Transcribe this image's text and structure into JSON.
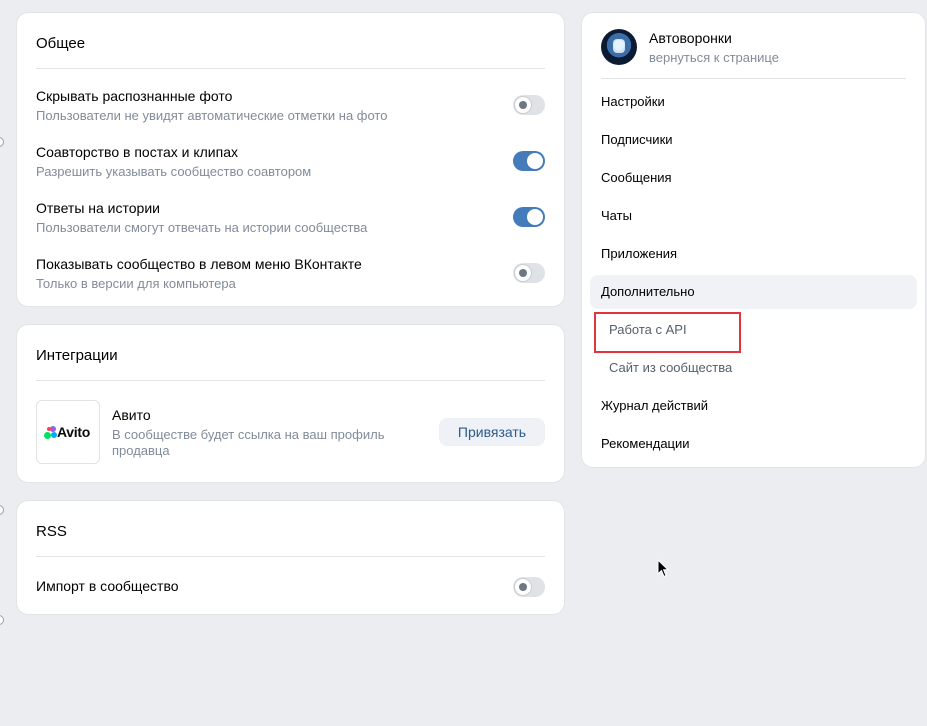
{
  "general": {
    "title": "Общее",
    "settings": [
      {
        "title": "Скрывать распознанные фото",
        "subtitle": "Пользователи не увидят автоматические отметки на фото",
        "enabled": false
      },
      {
        "title": "Соавторство в постах и клипах",
        "subtitle": "Разрешить указывать сообщество соавтором",
        "enabled": true
      },
      {
        "title": "Ответы на истории",
        "subtitle": "Пользователи смогут отвечать на истории сообщества",
        "enabled": true
      },
      {
        "title": "Показывать сообщество в левом меню ВКонтакте",
        "subtitle": "Только в версии для компьютера",
        "enabled": false
      }
    ]
  },
  "integrations": {
    "title": "Интеграции",
    "avito": {
      "logo_text": "Avito",
      "name": "Авито",
      "description_line1": "В сообществе будет ссылка на ваш профиль",
      "description_line2": "продавца",
      "button_label": "Привязать"
    }
  },
  "rss": {
    "title": "RSS",
    "import_label": "Импорт в сообщество",
    "import_enabled": false
  },
  "sidebar": {
    "community_name": "Автоворонки",
    "back_link": "вернуться к странице",
    "items": [
      {
        "label": "Настройки"
      },
      {
        "label": "Подписчики"
      },
      {
        "label": "Сообщения"
      },
      {
        "label": "Чаты"
      },
      {
        "label": "Приложения"
      },
      {
        "label": "Дополнительно"
      },
      {
        "label": "Работа с API"
      },
      {
        "label": "Сайт из сообщества"
      },
      {
        "label": "Журнал действий"
      },
      {
        "label": "Рекомендации"
      }
    ]
  },
  "colors": {
    "toggle_on": "#447bba",
    "link": "#2d5b8d",
    "highlight": "#e0353c"
  }
}
